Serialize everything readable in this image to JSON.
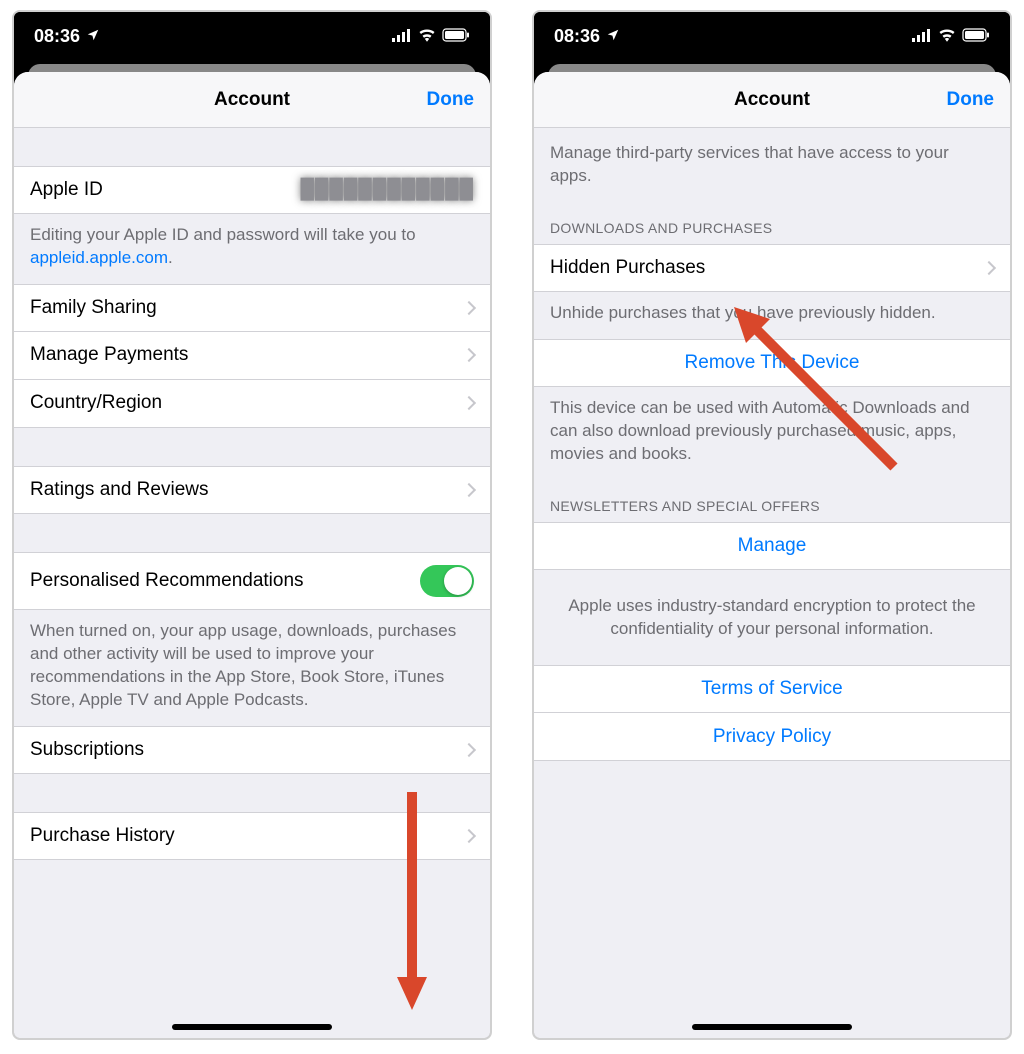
{
  "status": {
    "time": "08:36"
  },
  "nav": {
    "title": "Account",
    "done": "Done"
  },
  "left": {
    "apple_id_label": "Apple ID",
    "apple_id_value": "████████████",
    "apple_id_footer_pre": "Editing your Apple ID and password will take you to ",
    "apple_id_footer_link": "appleid.apple.com",
    "apple_id_footer_post": ".",
    "family_sharing": "Family Sharing",
    "manage_payments": "Manage Payments",
    "country_region": "Country/Region",
    "ratings_reviews": "Ratings and Reviews",
    "personalised": "Personalised Recommendations",
    "personalised_footer": "When turned on, your app usage, downloads, purchases and other activity will be used to improve your recommendations in the App Store, Book Store, iTunes Store, Apple TV and Apple Podcasts.",
    "subscriptions": "Subscriptions",
    "purchase_history": "Purchase History"
  },
  "right": {
    "third_party_footer": "Manage third-party services that have access to your apps.",
    "downloads_header": "DOWNLOADS AND PURCHASES",
    "hidden_purchases": "Hidden Purchases",
    "hidden_footer": "Unhide purchases that you have previously hidden.",
    "remove_device": "Remove This Device",
    "remove_footer": "This device can be used with Automatic Downloads and can also download previously purchased music, apps, movies and books.",
    "newsletters_header": "NEWSLETTERS AND SPECIAL OFFERS",
    "manage": "Manage",
    "encryption": "Apple uses industry-standard encryption to protect the confidentiality of your personal information.",
    "terms": "Terms of Service",
    "privacy": "Privacy Policy"
  }
}
